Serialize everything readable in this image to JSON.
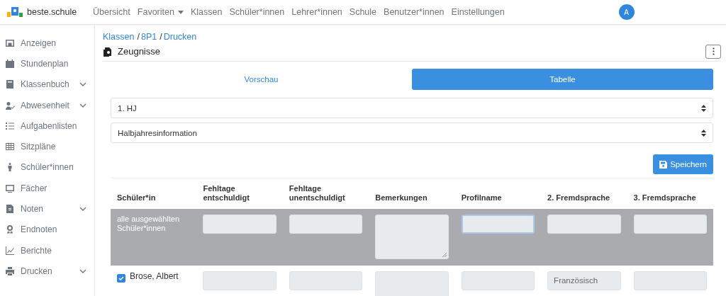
{
  "brand": "beste.schule",
  "nav": [
    {
      "label": "Übersicht",
      "dropdown": false
    },
    {
      "label": "Favoriten",
      "dropdown": true
    },
    {
      "label": "Klassen",
      "dropdown": false
    },
    {
      "label": "Schüler*innen",
      "dropdown": false
    },
    {
      "label": "Lehrer*innen",
      "dropdown": false
    },
    {
      "label": "Schule",
      "dropdown": false
    },
    {
      "label": "Benutzer*innen",
      "dropdown": false
    },
    {
      "label": "Einstellungen",
      "dropdown": false
    }
  ],
  "avatar": "A",
  "sidebar": {
    "items": [
      {
        "label": "Anzeigen",
        "submenu": false
      },
      {
        "label": "Stundenplan",
        "submenu": false
      },
      {
        "label": "Klassenbuch",
        "submenu": true
      },
      {
        "label": "Abwesenheit",
        "submenu": true
      },
      {
        "label": "Aufgabenlisten",
        "submenu": false
      },
      {
        "label": "Sitzpläne",
        "submenu": false
      },
      {
        "label": "Schüler*innen",
        "submenu": false
      },
      {
        "label": "Fächer",
        "submenu": false
      },
      {
        "label": "Noten",
        "submenu": true
      },
      {
        "label": "Endnoten",
        "submenu": false
      },
      {
        "label": "Berichte",
        "submenu": false
      },
      {
        "label": "Drucken",
        "submenu": true
      }
    ]
  },
  "breadcrumb": {
    "separator": "/",
    "items": [
      "Klassen",
      "8P1",
      "Drucken"
    ]
  },
  "page_title": "Zeugnisse",
  "tabs": [
    {
      "label": "Vorschau",
      "selected": false
    },
    {
      "label": "Tabelle",
      "selected": true
    }
  ],
  "selects": [
    {
      "value": "1. HJ"
    },
    {
      "value": "Halbjahresinformation"
    }
  ],
  "save_button": "Speichern",
  "table": {
    "columns": [
      "Schüler*in",
      "Fehltage entschuldigt",
      "Fehltage unentschuldigt",
      "Bemerkungen",
      "Profilname",
      "2. Fremdsprache",
      "3. Fremdsprache"
    ],
    "rows": [
      {
        "kind": "bulk",
        "cells": [
          {
            "kind": "label",
            "text": "alle ausgewählten Schüler*innen"
          },
          {
            "kind": "input",
            "focused": false
          },
          {
            "kind": "input",
            "focused": false
          },
          {
            "kind": "textarea",
            "focused": false
          },
          {
            "kind": "input",
            "focused": true
          },
          {
            "kind": "input",
            "focused": false
          },
          {
            "kind": "input",
            "focused": false
          }
        ]
      },
      {
        "kind": "student",
        "cells": [
          {
            "kind": "student",
            "text": "Brose, Albert",
            "checked": true
          },
          {
            "kind": "input",
            "focused": false
          },
          {
            "kind": "input",
            "focused": false
          },
          {
            "kind": "textarea",
            "focused": false
          },
          {
            "kind": "input",
            "focused": false
          },
          {
            "kind": "input",
            "focused": false,
            "value": "Französisch"
          },
          {
            "kind": "input",
            "focused": false
          }
        ]
      }
    ]
  }
}
